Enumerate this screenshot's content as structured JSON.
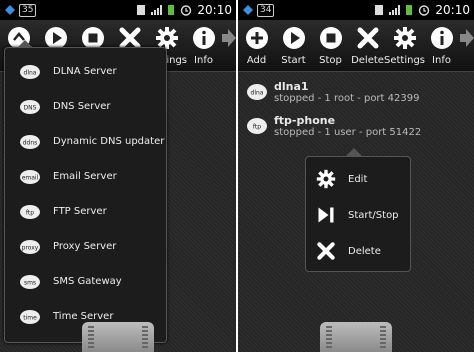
{
  "left": {
    "status": {
      "badge": "35",
      "time": "20:10"
    },
    "toolbar": [
      {
        "icon": "dlna-icon",
        "label": ""
      },
      {
        "icon": "play-icon",
        "label": ""
      },
      {
        "icon": "stop-icon",
        "label": ""
      },
      {
        "icon": "delete-icon",
        "label": ""
      },
      {
        "icon": "gear-icon",
        "label": "Settings"
      },
      {
        "icon": "info-icon",
        "label": "Info"
      }
    ],
    "menu": [
      {
        "icon_text": "dlna",
        "label": "DLNA Server"
      },
      {
        "icon_text": "DNS",
        "label": "DNS Server"
      },
      {
        "icon_text": "ddns",
        "label": "Dynamic DNS updater"
      },
      {
        "icon_text": "email",
        "label": "Email Server"
      },
      {
        "icon_text": "ftp",
        "label": "FTP Server"
      },
      {
        "icon_text": "proxy",
        "label": "Proxy Server"
      },
      {
        "icon_text": "sms",
        "label": "SMS Gateway"
      },
      {
        "icon_text": "time",
        "label": "Time Server"
      }
    ]
  },
  "right": {
    "status": {
      "badge": "34",
      "time": "20:10"
    },
    "toolbar": [
      {
        "icon": "plus-icon",
        "label": "Add"
      },
      {
        "icon": "play-icon",
        "label": "Start"
      },
      {
        "icon": "stop-icon",
        "label": "Stop"
      },
      {
        "icon": "delete-icon",
        "label": "Delete"
      },
      {
        "icon": "gear-icon",
        "label": "Settings"
      },
      {
        "icon": "info-icon",
        "label": "Info"
      }
    ],
    "servers": [
      {
        "icon_text": "dlna",
        "name": "dlna1",
        "status": "stopped - 1 root - port 42399"
      },
      {
        "icon_text": "ftp",
        "name": "ftp-phone",
        "status": "stopped - 1 user - port 51422"
      }
    ],
    "context_menu": [
      {
        "icon": "gear-icon",
        "label": "Edit"
      },
      {
        "icon": "play-pause-icon",
        "label": "Start/Stop"
      },
      {
        "icon": "delete-icon",
        "label": "Delete"
      }
    ]
  }
}
